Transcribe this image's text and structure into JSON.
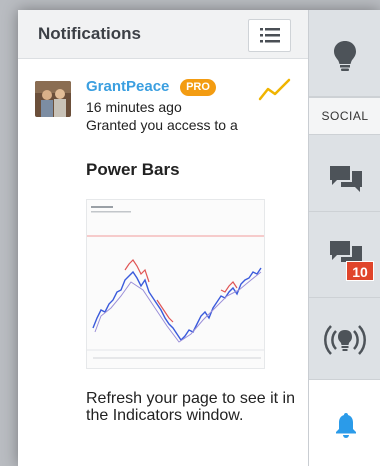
{
  "panel": {
    "title": "Notifications",
    "list_icon": "list-icon"
  },
  "notification": {
    "username": "GrantPeace",
    "badge": "PRO",
    "time": "16 minutes ago",
    "message": "Granted you access to a",
    "script_title": "Power Bars",
    "footer_message": "Refresh your page to see it in the Indicators window.",
    "trend_icon": "trend-line-icon",
    "accent_color": "#3b9fe0",
    "badge_color": "#f39c12"
  },
  "sidebar": {
    "items": [
      {
        "name": "ideas",
        "icon": "lightbulb-icon"
      },
      {
        "name": "social-label",
        "label": "SOCIAL"
      },
      {
        "name": "chats",
        "icon": "chat-bubbles-icon"
      },
      {
        "name": "private-messages",
        "icon": "private-chat-icon",
        "badge": "10"
      },
      {
        "name": "streams",
        "icon": "broadcast-icon"
      },
      {
        "name": "notifications",
        "icon": "bell-icon",
        "active": true
      }
    ],
    "badge_color": "#e0452b",
    "bell_color": "#2b9be9"
  }
}
